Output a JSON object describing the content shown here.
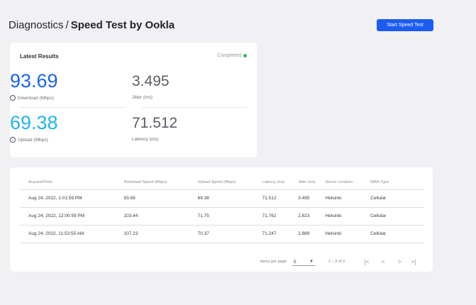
{
  "header": {
    "breadcrumb_parent": "Diagnostics",
    "separator": "/",
    "current_page": "Speed Test by Ookla",
    "start_button_label": "Start Speed Test",
    "accent_color": "#1c5cf0"
  },
  "results": {
    "title": "Latest Results",
    "status": "Completed",
    "status_color": "#3fb55d",
    "download": {
      "value": "93.69",
      "label": "Download (Mbps)",
      "icon": "download-icon"
    },
    "upload": {
      "value": "69.38",
      "label": "Upload (Mbps)",
      "icon": "upload-icon"
    },
    "jitter": {
      "value": "3.495",
      "label": "Jitter (ms)"
    },
    "latency": {
      "value": "71.512",
      "label": "Latency (ms)"
    }
  },
  "table": {
    "headers": [
      "AcquiredTime",
      "Download Speed (Mbps)",
      "Upload Speed (Mbps)",
      "Latency (ms)",
      "Jitter (ms)",
      "Server Location",
      "WAN Type"
    ],
    "rows": [
      [
        "Aug 24, 2022, 1:01:59 PM",
        "93.69",
        "69.38",
        "71.512",
        "3.495",
        "Helsinki",
        "Cellular"
      ],
      [
        "Aug 24, 2022, 12:00:59 PM",
        "103.44",
        "71.75",
        "71.762",
        "2.823",
        "Helsinki",
        "Cellular"
      ],
      [
        "Aug 24, 2022, 11:53:55 AM",
        "107.23",
        "70.37",
        "71.247",
        "2.889",
        "Helsinki",
        "Cellular"
      ]
    ]
  },
  "paginator": {
    "items_per_page_label": "Items per page:",
    "items_per_page_value": "5",
    "range_label": "1 – 3 of 3",
    "first_icon": "first-page-icon",
    "prev_icon": "previous-page-icon",
    "next_icon": "next-page-icon",
    "last_icon": "last-page-icon"
  }
}
